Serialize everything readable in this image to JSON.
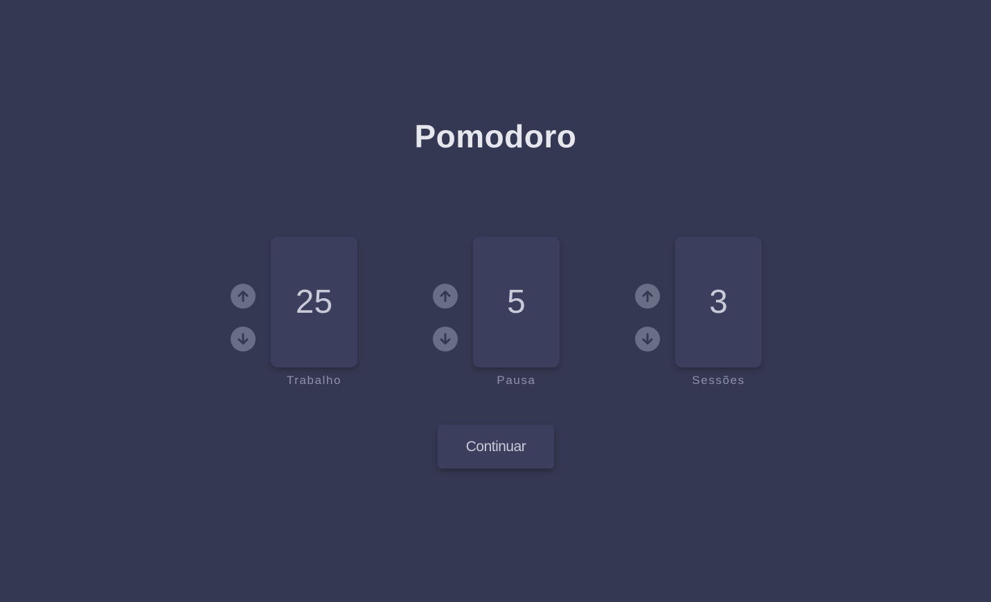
{
  "title": "Pomodoro",
  "settings": [
    {
      "value": "25",
      "label": "Trabalho",
      "up_icon": "arrow-up-circle-icon",
      "down_icon": "arrow-down-circle-icon"
    },
    {
      "value": "5",
      "label": "Pausa",
      "up_icon": "arrow-up-circle-icon",
      "down_icon": "arrow-down-circle-icon"
    },
    {
      "value": "3",
      "label": "Sessões",
      "up_icon": "arrow-up-circle-icon",
      "down_icon": "arrow-down-circle-icon"
    }
  ],
  "continue_label": "Continuar",
  "colors": {
    "background": "#353852",
    "card": "#3c3e5e",
    "title": "#e6e6ee",
    "value_text": "#c9cad8",
    "label_text": "#8f91a8",
    "arrow_icon": "#6a6d86"
  }
}
